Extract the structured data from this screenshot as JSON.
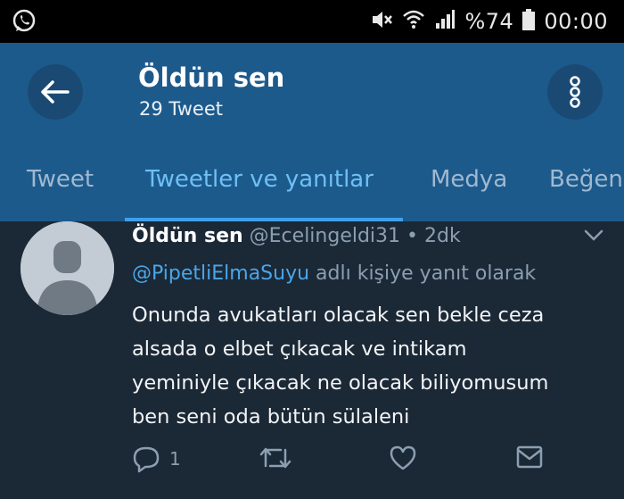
{
  "status_bar": {
    "battery": "%74",
    "time": "00:00",
    "icons": [
      "whatsapp-icon",
      "mute-icon",
      "wifi-icon",
      "signal-icon",
      "battery-icon"
    ]
  },
  "header": {
    "title": "Öldün sen",
    "subtitle": "29 Tweet"
  },
  "tabs": [
    {
      "label": "Tweet"
    },
    {
      "label": "Tweetler ve yanıtlar",
      "active": true
    },
    {
      "label": "Medya"
    },
    {
      "label": "Beğeni"
    }
  ],
  "tweet": {
    "name": "Öldün sen",
    "handle": "@Ecelingeldi31",
    "separator": "•",
    "time": "2dk",
    "reply_to": "@PipetliElmaSuyu",
    "reply_suffix": " adlı kişiye yanıt olarak",
    "text_lines": [
      "Onunda avukatları olacak sen bekle ceza",
      "alsada o elbet çıkacak ve intikam",
      "yeminiyle çıkacak ne olacak biliyomusum",
      "ben seni oda bütün sülaleni"
    ],
    "reply_count": "1"
  },
  "colors": {
    "header_bg": "#1d5a8c",
    "accent": "#3ea0ec",
    "background": "#1b2836"
  }
}
